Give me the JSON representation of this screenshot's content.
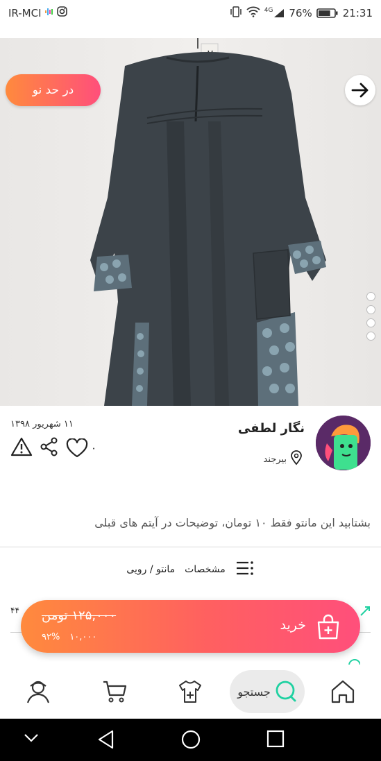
{
  "status_bar": {
    "carrier": "IR-MCI",
    "network": "4G",
    "battery_percent": "76%",
    "battery_level": 0.76,
    "time": "21:31"
  },
  "listing": {
    "price_badge": "در حد نو",
    "slider": {
      "total_images": 4,
      "current_index": 1
    },
    "seller": {
      "name": "نگار لطفی",
      "city": "بیرجند"
    },
    "date": "۱۱ شهریور ۱۳۹۸",
    "likes": "۰",
    "description": "بشتابید این مانتو فقط ۱۰ تومان، توضیحات در آیتم های قبلی",
    "specs_label": "مشخصات",
    "category": "مانتو / رویی"
  },
  "hidden_row": {
    "count": "۴۴"
  },
  "buy_bar": {
    "label": "خرید",
    "old_price": "۱۲۵,۰۰۰ تومن",
    "new_price": "۱۰,۰۰۰",
    "discount": "۹۲%"
  },
  "bottom_nav": {
    "search_label": "جستجو"
  },
  "colors": {
    "accent_start": "#ff8a3d",
    "accent_end": "#ff4f7b",
    "teal": "#1fd1a1"
  }
}
